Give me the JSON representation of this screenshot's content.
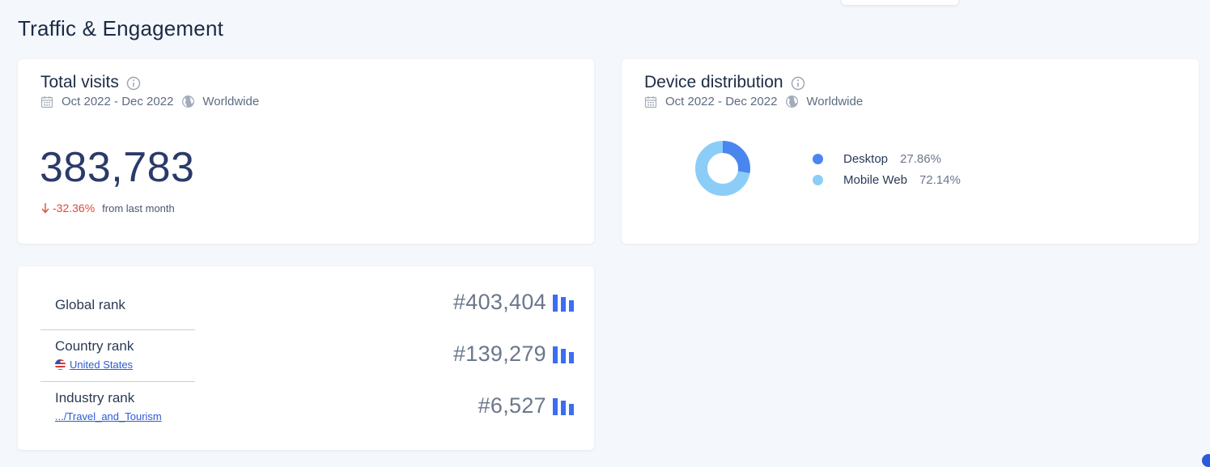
{
  "section": {
    "title": "Traffic & Engagement"
  },
  "visits": {
    "title": "Total visits",
    "period": "Oct 2022 - Dec 2022",
    "region": "Worldwide",
    "value": "383,783",
    "change": "-32.36%",
    "change_note": "from last month",
    "change_color": "#e2473a"
  },
  "device": {
    "title": "Device distribution",
    "period": "Oct 2022 - Dec 2022",
    "region": "Worldwide",
    "items": [
      {
        "label": "Desktop",
        "value": "27.86%",
        "share": 27.86,
        "color": "#4a86f0"
      },
      {
        "label": "Mobile Web",
        "value": "72.14%",
        "share": 72.14,
        "color": "#8ccdf8"
      }
    ]
  },
  "ranks": [
    {
      "label": "Global rank",
      "sub": "",
      "value": "#403,404"
    },
    {
      "label": "Country rank",
      "sub": "United States",
      "value": "#139,279"
    },
    {
      "label": "Industry rank",
      "sub": ".../Travel_and_Tourism",
      "value": "#6,527"
    }
  ],
  "icons": {
    "info": "info-icon",
    "calendar": "calendar-icon",
    "globe": "globe-icon",
    "arrow": "arrow-down-icon",
    "flag": "us-flag-icon",
    "bars": "bar-chart-icon"
  },
  "colors": {
    "accent": "#2d5bd8",
    "bars": "#3b6ef0"
  }
}
